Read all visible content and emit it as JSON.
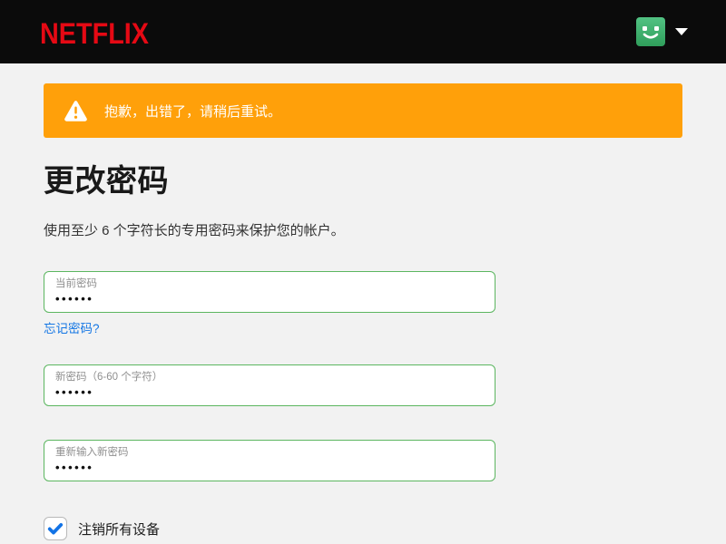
{
  "header": {
    "logo_text": "NETFLIX"
  },
  "icons": {
    "warning": "warning-triangle-icon",
    "avatar": "profile-avatar-icon",
    "caret": "chevron-down-icon"
  },
  "alert": {
    "message": "抱歉，出错了，请稍后重试。"
  },
  "page": {
    "title": "更改密码",
    "subtitle": "使用至少 6 个字符长的专用密码来保护您的帐户。"
  },
  "form": {
    "current_password": {
      "label": "当前密码",
      "value": "••••••"
    },
    "forgot_password_link": "忘记密码?",
    "new_password": {
      "label": "新密码（6-60 个字符）",
      "value": "••••••"
    },
    "confirm_password": {
      "label": "重新输入新密码",
      "value": "••••••"
    },
    "signout_all_devices": {
      "label": "注销所有设备",
      "checked": true
    }
  },
  "colors": {
    "brand_red": "#E50914",
    "banner_orange": "#FFA00A",
    "input_border_green": "#5CB660",
    "link_blue": "#1476E4",
    "check_blue": "#1273E6",
    "header_black": "#0B0B0B",
    "page_background": "#F2F2F2",
    "avatar_green": "#3FB573"
  }
}
